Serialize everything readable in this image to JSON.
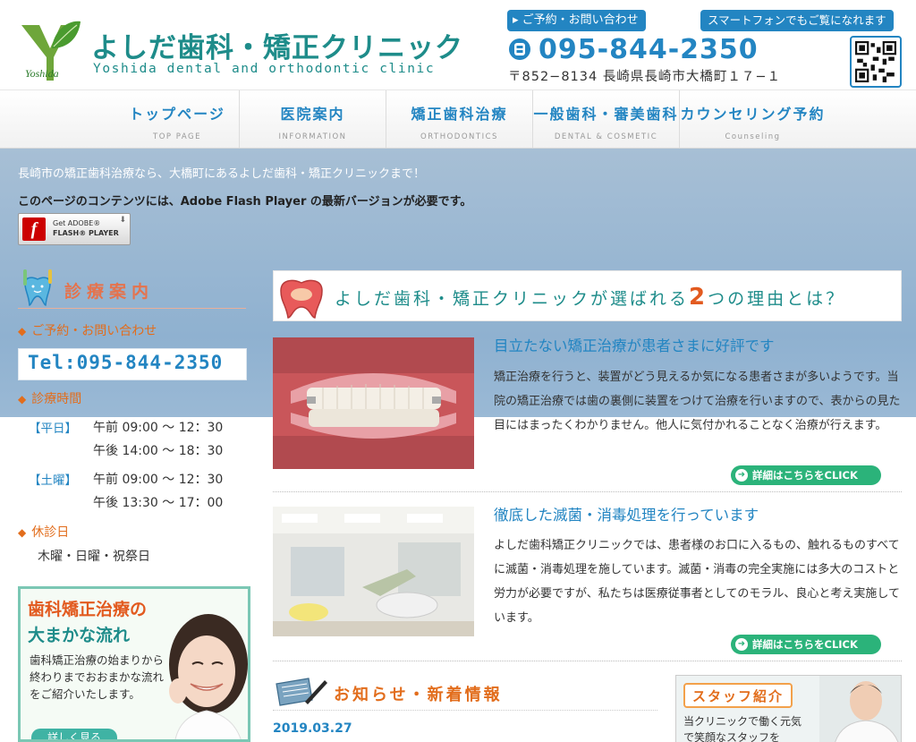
{
  "header": {
    "logo_title": "よしだ歯科・矯正クリニック",
    "logo_subtitle": "Yoshida dental and orthodontic clinic",
    "logo_script": "Yoshida",
    "contact_tag": "ご予約・お問い合わせ",
    "phone": "095-844-2350",
    "address": "〒852−8134 長崎県長崎市大橋町１７−１",
    "smartphone_tag": "スマートフォンでもご覧になれます"
  },
  "nav": [
    {
      "label": "トップページ",
      "sub": "TOP PAGE"
    },
    {
      "label": "医院案内",
      "sub": "INFORMATION"
    },
    {
      "label": "矯正歯科治療",
      "sub": "ORTHODONTICS"
    },
    {
      "label": "一般歯科・審美歯科",
      "sub": "DENTAL & COSMETIC"
    },
    {
      "label": "カウンセリング予約",
      "sub": "Counseling"
    }
  ],
  "intro": {
    "tagline": "長崎市の矯正歯科治療なら、大橋町にあるよしだ歯科・矯正クリニックまで！",
    "flash_note": "このページのコンテンツには、Adobe Flash Player の最新バージョンが必要です。",
    "flash_btn_line1": "Get ADOBE®",
    "flash_btn_line2": "FLASH® PLAYER"
  },
  "sidebar": {
    "title": "診療案内",
    "contact_head": "ご予約・お問い合わせ",
    "phone": "Tel:095-844-2350",
    "hours_head": "診療時間",
    "weekday_label": "【平日】",
    "weekday_am": "午前 09:00 〜 12：30",
    "weekday_pm": "午後 14:00 〜 18：30",
    "saturday_label": "【土曜】",
    "saturday_am": "午前 09:00 〜 12：30",
    "saturday_pm": "午後 13:30 〜 17：00",
    "closed_head": "休診日",
    "closed_days": "木曜・日曜・祝祭日",
    "banner_line1": "歯科矯正治療の",
    "banner_line2": "大まかな流れ",
    "banner_desc": "歯科矯正治療の始まりから終わりまでおおまかな流れをご紹介いたします。",
    "banner_more": "詳しく見る"
  },
  "main": {
    "reasons_pre": "よしだ歯科・矯正クリニックが選ばれる",
    "reasons_num": "2",
    "reasons_post": "つの理由とは？",
    "feature1_title": "目立たない矯正治療が患者さまに好評です",
    "feature1_body": "矯正治療を行うと、装置がどう見えるか気になる患者さまが多いようです。当院の矯正治療では歯の裏側に装置をつけて治療を行いますので、表からの見た目にはまったくわかりません。他人に気付かれることなく治療が行えます。",
    "feature2_title": "徹底した滅菌・消毒処理を行っています",
    "feature2_body": "よしだ歯科矯正クリニックでは、患者様のお口に入るもの、触れるものすべてに滅菌・消毒処理を施しています。滅菌・消毒の完全実施には多大のコストと労力が必要ですが、私たちは医療従事者としてのモラル、良心と考え実施しています。",
    "detail_label": "詳細はこちらをCLICK",
    "news_title": "お知らせ・新着情報",
    "news_date": "2019.03.27",
    "staff_title": "スタッフ紹介",
    "staff_desc": "当クリニックで働く元気で笑顔なスタッフを"
  },
  "colors": {
    "accent_blue": "#2385c2",
    "accent_teal": "#1e8c8a",
    "accent_orange": "#e26d1c",
    "button_green": "#2bb37a",
    "band_blue": "#8fb1d0"
  }
}
